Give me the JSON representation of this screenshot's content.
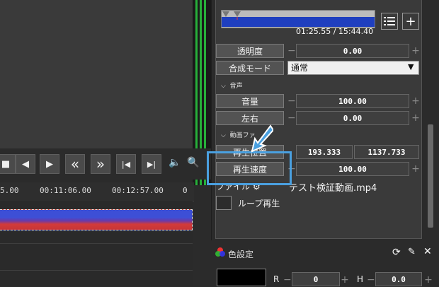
{
  "transport": {
    "buttons": [
      {
        "name": "stop-button",
        "glyph": "■"
      },
      {
        "name": "prev-frame-button",
        "glyph": "◀"
      },
      {
        "name": "next-frame-button",
        "glyph": "▶"
      },
      {
        "name": "rewind-button",
        "glyph": "«"
      },
      {
        "name": "fastforward-button",
        "glyph": "»"
      },
      {
        "name": "go-start-button",
        "glyph": "|◀"
      },
      {
        "name": "go-end-button",
        "glyph": "▶|"
      }
    ],
    "volume_icon": "🔈",
    "zoom_icon": "🔍"
  },
  "timeline": {
    "ticks": [
      "5.00",
      "00:11:06.00",
      "00:12:57.00",
      "0"
    ]
  },
  "object_panel": {
    "timecode": "01:25.55 / 15:44.40",
    "list_icon": "list-icon",
    "add_icon": "+",
    "opacity_label": "透明度",
    "opacity_value": "0.00",
    "blend_label": "合成モード",
    "blend_value": "通常",
    "audio_section": "音声",
    "volume_label": "音量",
    "volume_value": "100.00",
    "pan_label": "左右",
    "pan_value": "0.00",
    "video_section": "動画ファ",
    "play_pos_label": "再生位置",
    "play_pos_start": "193.333",
    "play_pos_end": "1137.733",
    "speed_label": "再生速度",
    "speed_value": "100.00",
    "file_label": "ファイル",
    "file_name": "テスト検証動画.mp4",
    "loop_label": "ループ再生"
  },
  "color_panel": {
    "title": "色設定",
    "r_label": "R",
    "r_value": "0",
    "h_label": "H",
    "h_value": "0.0"
  },
  "colors": {
    "meter_green": "#27b03a",
    "seek_blue": "#1f3fbf",
    "highlight": "#4aa0e0"
  }
}
